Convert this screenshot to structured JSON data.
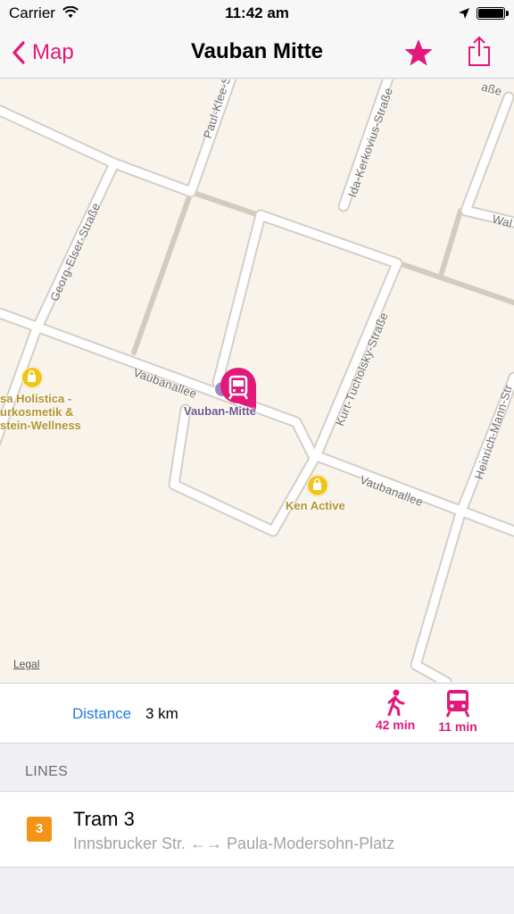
{
  "status_bar": {
    "carrier": "Carrier",
    "time": "11:42 am"
  },
  "nav": {
    "back_label": "Map",
    "title": "Vauban Mitte",
    "accent_color": "#e2187a"
  },
  "map": {
    "streets": {
      "paul_klee": "Paul-Klee-S",
      "ida_kerkovius": "Ida-Kerkovius-Straße",
      "georg_elser": "Georg-Elser-Straße",
      "vaubanallee_left": "Vaubanallee",
      "vaubanallee_right": "Vaubanallee",
      "kurt_tucholsky": "Kurt-Tucholsky-Straße",
      "heinrich_mann": "Heinrich-Mann-Str",
      "wal": "Wal",
      "top_right": "aße"
    },
    "pois": {
      "holistica_line1": "sa Holistica -",
      "holistica_line2": "urkosmetik &",
      "holistica_line3": "stein-Wellness",
      "ken_active": "Ken Active"
    },
    "stop_label": "Vauban-Mitte",
    "legal": "Legal"
  },
  "info": {
    "distance_label": "Distance",
    "distance_value": "3 km",
    "walk_time": "42 min",
    "tram_time": "11 min"
  },
  "lines_section": {
    "header": "LINES",
    "items": [
      {
        "badge": "3",
        "name": "Tram 3",
        "route": "Innsbrucker Str. ←→ Paula-Modersohn-Platz",
        "badge_color": "#f39418"
      }
    ]
  }
}
